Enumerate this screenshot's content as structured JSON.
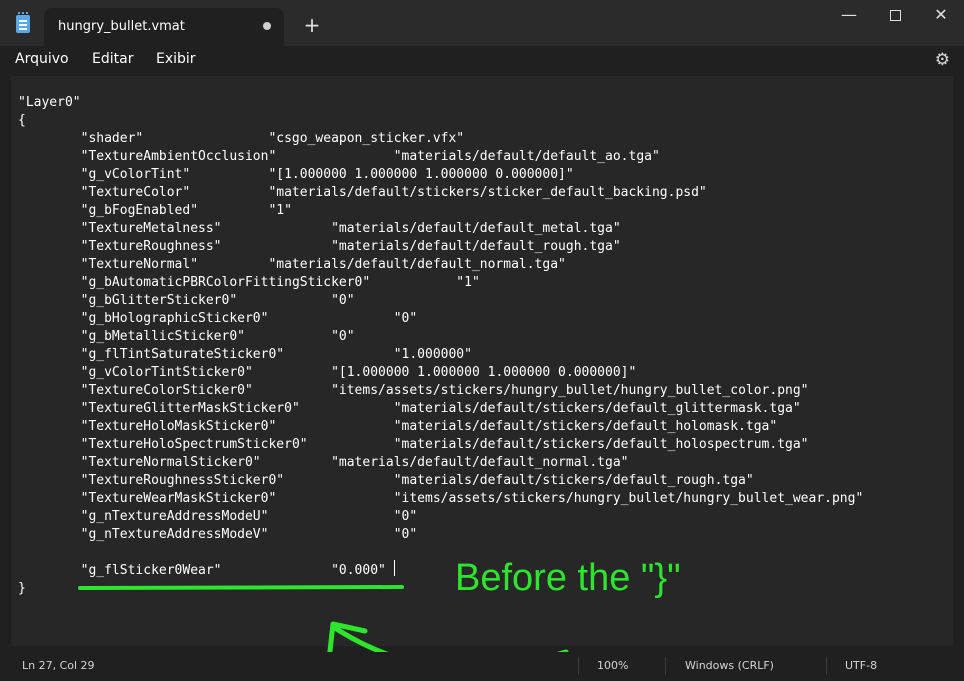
{
  "window": {
    "tab_title": "hungry_bullet.vmat",
    "new_tab_symbol": "+",
    "minimize_symbol": "—",
    "close_symbol": "✕"
  },
  "menu": {
    "file": "Arquivo",
    "edit": "Editar",
    "view": "Exibir"
  },
  "icons": {
    "app": "notepad-icon",
    "settings": "gear-icon",
    "tab_status": "unsaved-dot-icon"
  },
  "editor": {
    "content": "\"Layer0\"\n{\n\t\"shader\"\t\t\"csgo_weapon_sticker.vfx\"\n\t\"TextureAmbientOcclusion\"\t\t\"materials/default/default_ao.tga\"\n\t\"g_vColorTint\"\t\t\"[1.000000 1.000000 1.000000 0.000000]\"\n\t\"TextureColor\"\t\t\"materials/default/stickers/sticker_default_backing.psd\"\n\t\"g_bFogEnabled\"\t\t\"1\"\n\t\"TextureMetalness\"\t\t\"materials/default/default_metal.tga\"\n\t\"TextureRoughness\"\t\t\"materials/default/default_rough.tga\"\n\t\"TextureNormal\"\t\t\"materials/default/default_normal.tga\"\n\t\"g_bAutomaticPBRColorFittingSticker0\"\t\t\"1\"\n\t\"g_bGlitterSticker0\"\t\t\"0\"\n\t\"g_bHolographicSticker0\"\t\t\"0\"\n\t\"g_bMetallicSticker0\"\t\t\"0\"\n\t\"g_flTintSaturateSticker0\"\t\t\"1.000000\"\n\t\"g_vColorTintSticker0\"\t\t\"[1.000000 1.000000 1.000000 0.000000]\"\n\t\"TextureColorSticker0\"\t\t\"items/assets/stickers/hungry_bullet/hungry_bullet_color.png\"\n\t\"TextureGlitterMaskSticker0\"\t\t\"materials/default/stickers/default_glittermask.tga\"\n\t\"TextureHoloMaskSticker0\"\t\t\"materials/default/stickers/default_holomask.tga\"\n\t\"TextureHoloSpectrumSticker0\"\t\t\"materials/default/stickers/default_holospectrum.tga\"\n\t\"TextureNormalSticker0\"\t\t\"materials/default/default_normal.tga\"\n\t\"TextureRoughnessSticker0\"\t\t\"materials/default/stickers/default_rough.tga\"\n\t\"TextureWearMaskSticker0\"\t\t\"items/assets/stickers/hungry_bullet/hungry_bullet_wear.png\"\n\t\"g_nTextureAddressModeU\"\t\t\"0\"\n\t\"g_nTextureAddressModeV\"\t\t\"0\"\n\n\t\"g_flSticker0Wear\"\t\t\"0.000\"\n}"
  },
  "annotation": {
    "text": "Before the \"}\"",
    "color": "#2ee52e"
  },
  "status": {
    "position": "Ln 27, Col 29",
    "zoom": "100%",
    "line_ending": "Windows (CRLF)",
    "encoding": "UTF-8"
  }
}
